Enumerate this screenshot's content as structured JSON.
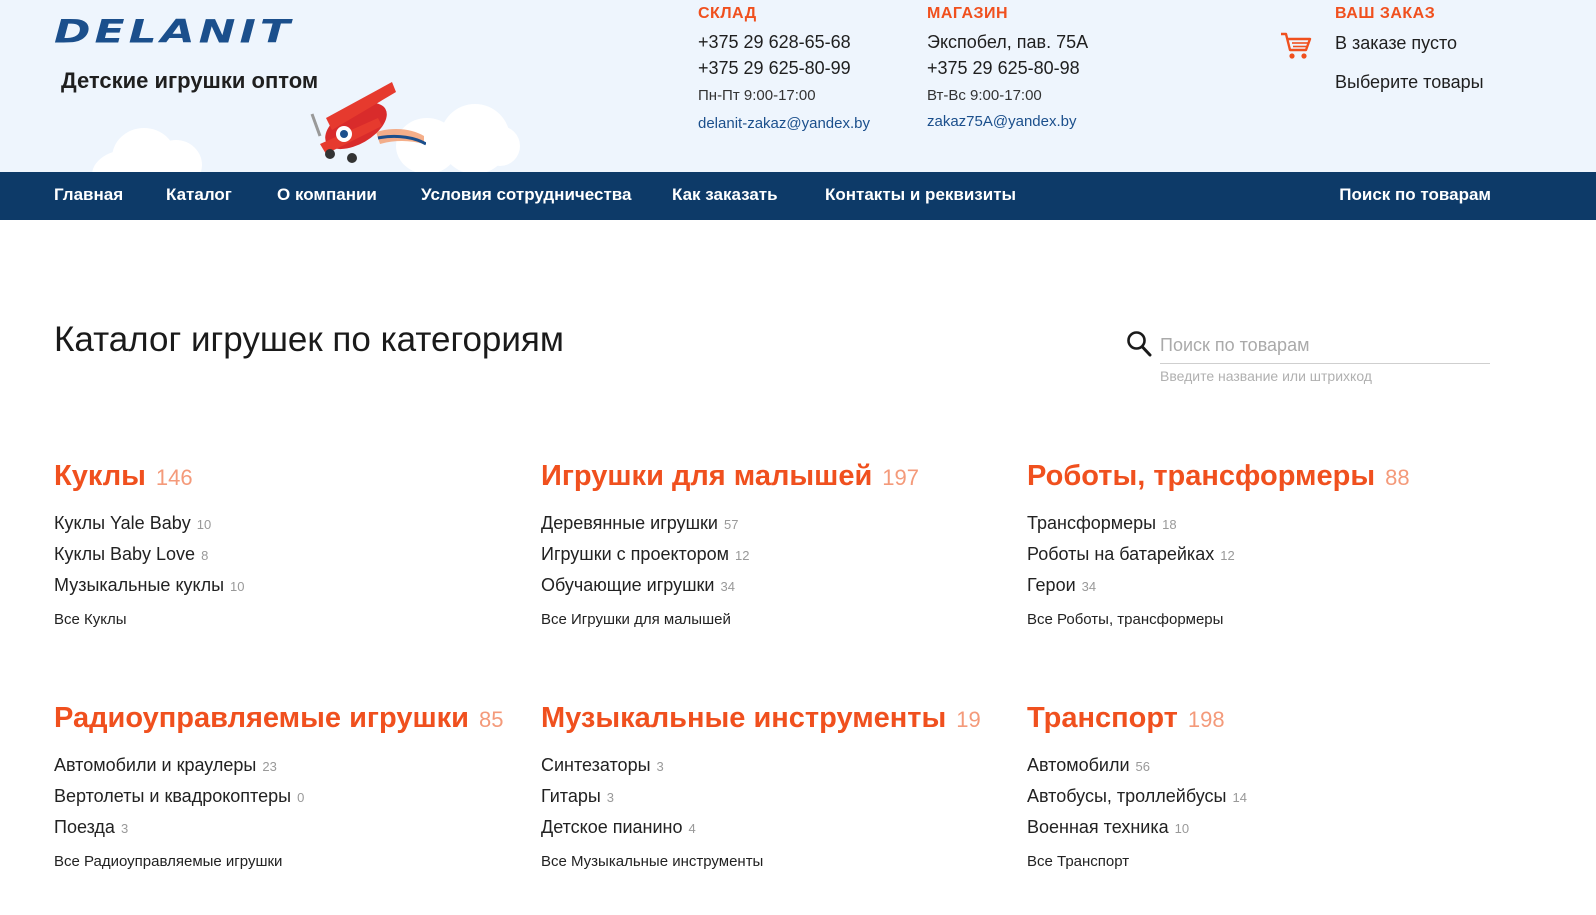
{
  "brand": {
    "logo_text": "DELANIT",
    "tagline": "Детские игрушки оптом"
  },
  "contacts": {
    "warehouse": {
      "title": "СКЛАД",
      "phone1": "+375 29 628-65-68",
      "phone2": "+375 29 625-80-99",
      "hours": "Пн-Пт 9:00-17:00",
      "email": "delanit-zakaz@yandex.by"
    },
    "shop": {
      "title": "МАГАЗИН",
      "address": "Экспобел, пав. 75А",
      "phone": "+375 29 625-80-98",
      "hours": "Вт-Вс 9:00-17:00",
      "email": "zakaz75A@yandex.by"
    },
    "order": {
      "title": "ВАШ ЗАКАЗ",
      "status": "В заказе пусто",
      "hint": "Выберите товары"
    }
  },
  "nav": {
    "items": [
      "Главная",
      "Каталог",
      "О компании",
      "Условия сотрудничества",
      "Как заказать",
      "Контакты и реквизиты"
    ],
    "search": "Поиск по товарам"
  },
  "catalog": {
    "title": "Каталог игрушек по категориям",
    "search_placeholder": "Поиск по товарам",
    "search_hint": "Введите название или штрихкод",
    "categories": [
      {
        "name": "Куклы",
        "count": "146",
        "subs": [
          {
            "name": "Куклы Yale Baby",
            "count": "10"
          },
          {
            "name": "Куклы Baby Love",
            "count": "8"
          },
          {
            "name": "Музыкальные куклы",
            "count": "10"
          }
        ],
        "all": "Все Куклы"
      },
      {
        "name": "Игрушки для малышей",
        "count": "197",
        "subs": [
          {
            "name": "Деревянные игрушки",
            "count": "57"
          },
          {
            "name": "Игрушки с проектором",
            "count": "12"
          },
          {
            "name": "Обучающие игрушки",
            "count": "34"
          }
        ],
        "all": "Все Игрушки для малышей"
      },
      {
        "name": "Роботы, трансформеры",
        "count": "88",
        "subs": [
          {
            "name": "Трансформеры",
            "count": "18"
          },
          {
            "name": "Роботы на батарейках",
            "count": "12"
          },
          {
            "name": "Герои",
            "count": "34"
          }
        ],
        "all": "Все Роботы, трансформеры"
      },
      {
        "name": "Радиоуправляемые игрушки",
        "count": "85",
        "subs": [
          {
            "name": "Автомобили и краулеры",
            "count": "23"
          },
          {
            "name": "Вертолеты и квадрокоптеры",
            "count": "0"
          },
          {
            "name": "Поезда",
            "count": "3"
          }
        ],
        "all": "Все Радиоуправляемые игрушки"
      },
      {
        "name": "Музыкальные инструменты",
        "count": "19",
        "subs": [
          {
            "name": "Синтезаторы",
            "count": "3"
          },
          {
            "name": "Гитары",
            "count": "3"
          },
          {
            "name": "Детское пианино",
            "count": "4"
          }
        ],
        "all": "Все Музыкальные инструменты"
      },
      {
        "name": "Транспорт",
        "count": "198",
        "subs": [
          {
            "name": "Автомобили",
            "count": "56"
          },
          {
            "name": "Автобусы, троллейбусы",
            "count": "14"
          },
          {
            "name": "Военная техника",
            "count": "10"
          }
        ],
        "all": "Все Транспорт"
      }
    ]
  },
  "colors": {
    "accent": "#f0501e",
    "nav_bg": "#0d3a68",
    "header_bg": "#eef5fd",
    "brand_blue": "#1b4f8c"
  },
  "icons": [
    "cart-icon",
    "search-icon",
    "airplane-illustration"
  ]
}
